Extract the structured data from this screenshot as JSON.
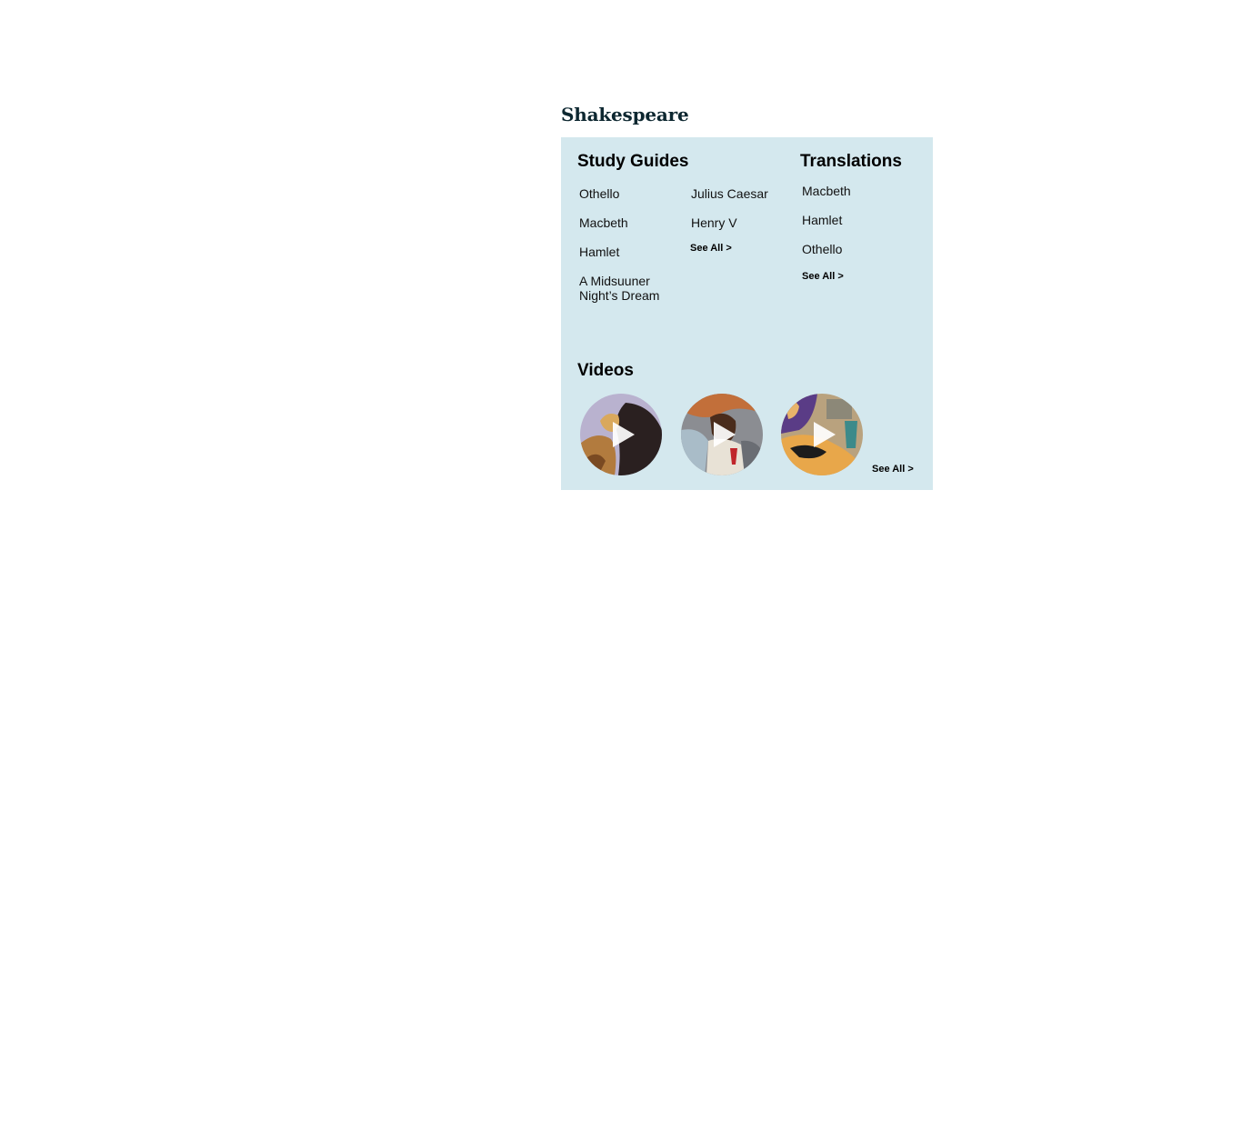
{
  "section": {
    "title": "Shakespeare"
  },
  "study_guides": {
    "heading": "Study Guides",
    "col1": [
      "Othello",
      "Macbeth",
      "Hamlet",
      "A Midsuuner Night’s Dream"
    ],
    "col2": [
      "Julius Caesar",
      "Henry V"
    ],
    "see_all": "See All >"
  },
  "translations": {
    "heading": "Translations",
    "items": [
      "Macbeth",
      "Hamlet",
      "Othello"
    ],
    "see_all": "See All >"
  },
  "videos": {
    "heading": "Videos",
    "thumbnails": [
      {
        "icon": "play-icon"
      },
      {
        "icon": "play-icon"
      },
      {
        "icon": "play-icon"
      }
    ],
    "see_all": "See All >"
  },
  "colors": {
    "panel_bg": "#d4e8ee",
    "title": "#0d2730"
  }
}
